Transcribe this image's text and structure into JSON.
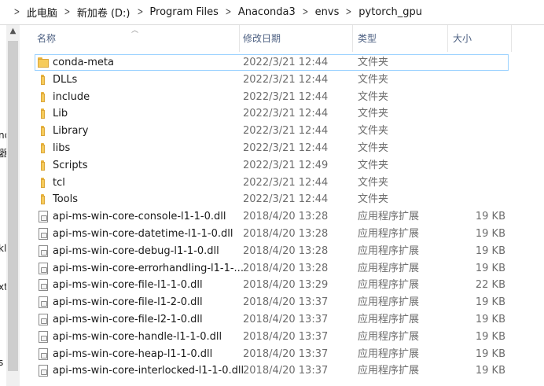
{
  "breadcrumb": {
    "items": [
      "此电脑",
      "新加卷 (D:)",
      "Program Files",
      "Anaconda3",
      "envs",
      "pytorch_gpu"
    ],
    "separator": ">"
  },
  "nav_fragments": [
    "nd",
    "器",
    "kl",
    "xt",
    "s"
  ],
  "columns": {
    "name": "名称",
    "date": "修改日期",
    "type": "类型",
    "size": "大小"
  },
  "rows": [
    {
      "name": "conda-meta",
      "date": "2022/3/21 12:44",
      "type": "文件夹",
      "size": "",
      "icon": "folder"
    },
    {
      "name": "DLLs",
      "date": "2022/3/21 12:44",
      "type": "文件夹",
      "size": "",
      "icon": "folder"
    },
    {
      "name": "include",
      "date": "2022/3/21 12:44",
      "type": "文件夹",
      "size": "",
      "icon": "folder"
    },
    {
      "name": "Lib",
      "date": "2022/3/21 12:44",
      "type": "文件夹",
      "size": "",
      "icon": "folder"
    },
    {
      "name": "Library",
      "date": "2022/3/21 12:44",
      "type": "文件夹",
      "size": "",
      "icon": "folder"
    },
    {
      "name": "libs",
      "date": "2022/3/21 12:44",
      "type": "文件夹",
      "size": "",
      "icon": "folder"
    },
    {
      "name": "Scripts",
      "date": "2022/3/21 12:49",
      "type": "文件夹",
      "size": "",
      "icon": "folder"
    },
    {
      "name": "tcl",
      "date": "2022/3/21 12:44",
      "type": "文件夹",
      "size": "",
      "icon": "folder"
    },
    {
      "name": "Tools",
      "date": "2022/3/21 12:44",
      "type": "文件夹",
      "size": "",
      "icon": "folder"
    },
    {
      "name": "api-ms-win-core-console-l1-1-0.dll",
      "date": "2018/4/20 13:28",
      "type": "应用程序扩展",
      "size": "19 KB",
      "icon": "dll"
    },
    {
      "name": "api-ms-win-core-datetime-l1-1-0.dll",
      "date": "2018/4/20 13:28",
      "type": "应用程序扩展",
      "size": "19 KB",
      "icon": "dll"
    },
    {
      "name": "api-ms-win-core-debug-l1-1-0.dll",
      "date": "2018/4/20 13:28",
      "type": "应用程序扩展",
      "size": "19 KB",
      "icon": "dll"
    },
    {
      "name": "api-ms-win-core-errorhandling-l1-1-...",
      "date": "2018/4/20 13:28",
      "type": "应用程序扩展",
      "size": "19 KB",
      "icon": "dll"
    },
    {
      "name": "api-ms-win-core-file-l1-1-0.dll",
      "date": "2018/4/20 13:29",
      "type": "应用程序扩展",
      "size": "22 KB",
      "icon": "dll"
    },
    {
      "name": "api-ms-win-core-file-l1-2-0.dll",
      "date": "2018/4/20 13:37",
      "type": "应用程序扩展",
      "size": "19 KB",
      "icon": "dll"
    },
    {
      "name": "api-ms-win-core-file-l2-1-0.dll",
      "date": "2018/4/20 13:37",
      "type": "应用程序扩展",
      "size": "19 KB",
      "icon": "dll"
    },
    {
      "name": "api-ms-win-core-handle-l1-1-0.dll",
      "date": "2018/4/20 13:37",
      "type": "应用程序扩展",
      "size": "19 KB",
      "icon": "dll"
    },
    {
      "name": "api-ms-win-core-heap-l1-1-0.dll",
      "date": "2018/4/20 13:37",
      "type": "应用程序扩展",
      "size": "19 KB",
      "icon": "dll"
    },
    {
      "name": "api-ms-win-core-interlocked-l1-1-0.dll",
      "date": "2018/4/20 13:37",
      "type": "应用程序扩展",
      "size": "19 KB",
      "icon": "dll"
    }
  ],
  "focused_row": 0,
  "colors": {
    "header_text": "#4d6082",
    "secondary_text": "#6d6d6d",
    "focus_border": "#99d1ff",
    "folder": "#f6cb5b"
  }
}
